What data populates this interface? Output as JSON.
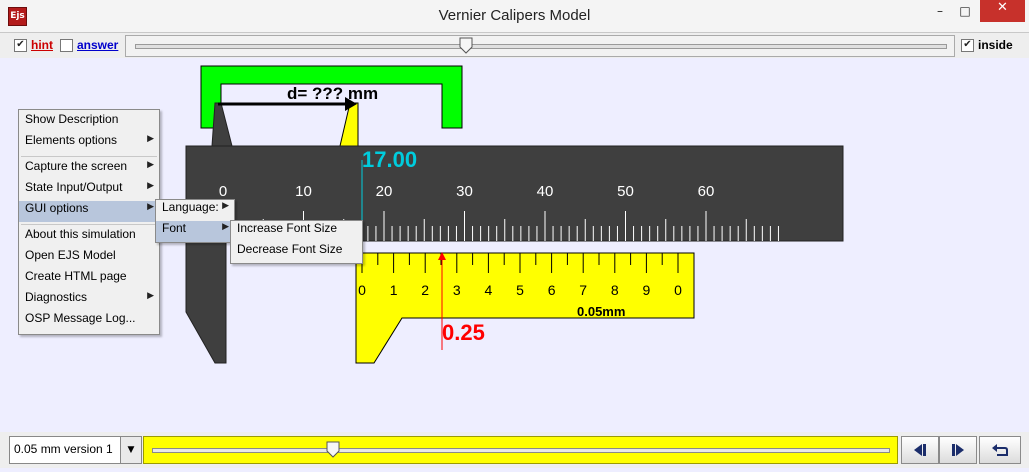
{
  "window": {
    "title": "Vernier Calipers Model",
    "app_icon": "Ejs",
    "controls": {
      "minimize": "–",
      "maximize": "□",
      "close": "✕"
    }
  },
  "toolbar": {
    "hint": {
      "label": "hint",
      "checked": true,
      "color": "#cc0000"
    },
    "answer": {
      "label": "answer",
      "checked": false,
      "color": "#0000cc"
    },
    "inside": {
      "label": "inside",
      "checked": true
    },
    "check_glyph": "✔"
  },
  "caliper": {
    "measurement_label": "d= ??? mm",
    "main_reading": "17.00",
    "vernier_reading": "0.25",
    "main_scale_labels": [
      "0",
      "10",
      "20",
      "30",
      "40",
      "50",
      "60"
    ],
    "vernier_labels": [
      "0",
      "1",
      "2",
      "3",
      "4",
      "5",
      "6",
      "7",
      "8",
      "9",
      "0"
    ],
    "vernier_unit": "0.05mm",
    "colors": {
      "jaw_green": "#00ff00",
      "main_scale": "#3f3f3f",
      "vernier": "#ffff00",
      "reading_cyan": "#00ccdd",
      "reading_red": "#ff0000"
    }
  },
  "context_menu": {
    "items": [
      {
        "label": "Show Description",
        "submenu": false
      },
      {
        "label": "Elements options",
        "submenu": true
      },
      {
        "label": "Capture the screen",
        "submenu": true
      },
      {
        "label": "State Input/Output",
        "submenu": true
      },
      {
        "label": "GUI options",
        "submenu": true,
        "highlighted": true
      },
      {
        "label": "About this simulation",
        "submenu": false
      },
      {
        "label": "Open EJS Model",
        "submenu": false
      },
      {
        "label": "Create HTML page",
        "submenu": false
      },
      {
        "label": "Diagnostics",
        "submenu": true
      },
      {
        "label": "OSP Message Log...",
        "submenu": false
      }
    ],
    "gui_submenu": [
      {
        "label": "Language:",
        "submenu": true
      },
      {
        "label": "Font",
        "submenu": true,
        "highlighted": true
      }
    ],
    "font_submenu": [
      {
        "label": "Increase Font Size"
      },
      {
        "label": "Decrease Font Size"
      }
    ]
  },
  "bottom": {
    "version_select": {
      "value": "0.05 mm version 1",
      "icon": "chevron-down-icon"
    },
    "buttons": [
      {
        "name": "step-back-button",
        "icon": "step-back-icon",
        "glyph": "◀|"
      },
      {
        "name": "step-forward-button",
        "icon": "step-forward-icon",
        "glyph": "|▶"
      },
      {
        "name": "reset-button",
        "icon": "reset-icon",
        "glyph": "↶"
      }
    ]
  }
}
